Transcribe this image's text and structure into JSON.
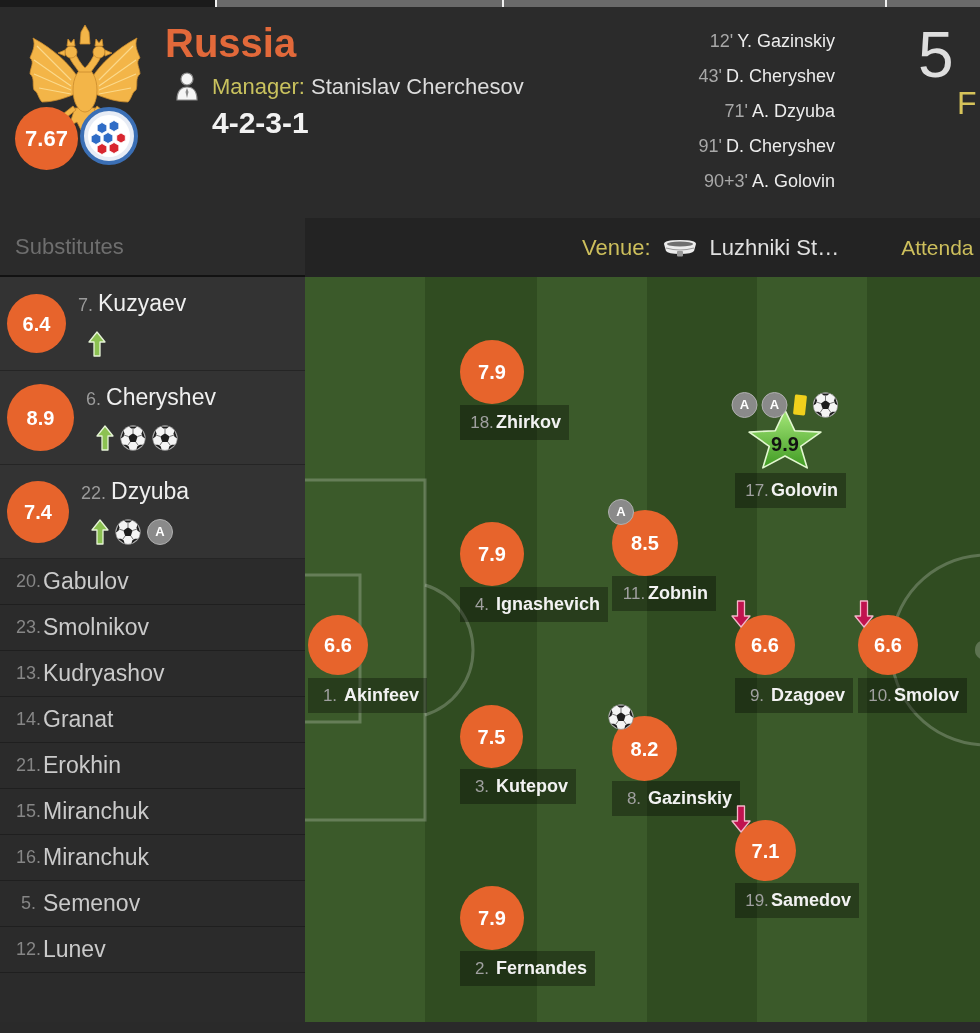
{
  "tabs": [
    {
      "selected": true
    },
    {
      "selected": false
    },
    {
      "selected": false
    },
    {
      "selected": false
    }
  ],
  "team": {
    "name": "Russia",
    "rating": "7.67",
    "manager_label": "Manager:",
    "manager": "Stanislav Cherchesov",
    "formation": "4-2-3-1"
  },
  "goals": [
    {
      "minute": "12'",
      "scorer": "Y. Gazinskiy"
    },
    {
      "minute": "43'",
      "scorer": "D. Cheryshev"
    },
    {
      "minute": "71'",
      "scorer": "A. Dzyuba"
    },
    {
      "minute": "91'",
      "scorer": "D. Cheryshev"
    },
    {
      "minute": "90+3'",
      "scorer": "A. Golovin"
    }
  ],
  "score": {
    "value": "5",
    "label": "F"
  },
  "match_info": {
    "venue_label": "Venue:",
    "venue": "Luzhniki St…",
    "attendance_label": "Attenda"
  },
  "substitutes": {
    "title": "Substitutes",
    "players": [
      {
        "kind": "played",
        "number": "7.",
        "name": "Kuzyaev",
        "rating": "6.4",
        "man_of_the_match": false,
        "events": [
          {
            "kind": "sub_on"
          }
        ]
      },
      {
        "kind": "played",
        "number": "6.",
        "name": "Cheryshev",
        "rating": "8.9",
        "man_of_the_match": false,
        "events": [
          {
            "kind": "sub_on"
          },
          {
            "kind": "goal"
          },
          {
            "kind": "goal"
          }
        ]
      },
      {
        "kind": "played",
        "number": "22.",
        "name": "Dzyuba",
        "rating": "7.4",
        "man_of_the_match": false,
        "events": [
          {
            "kind": "sub_on"
          },
          {
            "kind": "goal"
          },
          {
            "kind": "assist",
            "label": "A"
          }
        ]
      },
      {
        "kind": "unused",
        "number": "20.",
        "name": "Gabulov"
      },
      {
        "kind": "unused",
        "number": "23.",
        "name": "Smolnikov"
      },
      {
        "kind": "unused",
        "number": "13.",
        "name": "Kudryashov"
      },
      {
        "kind": "unused",
        "number": "14.",
        "name": "Granat"
      },
      {
        "kind": "unused",
        "number": "21.",
        "name": "Erokhin"
      },
      {
        "kind": "unused",
        "number": "15.",
        "name": "Miranchuk"
      },
      {
        "kind": "unused",
        "number": "16.",
        "name": "Miranchuk"
      },
      {
        "kind": "unused",
        "number": "5.",
        "name": "Semenov"
      },
      {
        "kind": "unused",
        "number": "12.",
        "name": "Lunev"
      }
    ]
  },
  "lineup": {
    "lines": [
      {
        "players": [
          {
            "number": "1.",
            "name": "Akinfeev",
            "rating": "6.6",
            "man_of_the_match": false
          }
        ]
      },
      {
        "players": [
          {
            "number": "18.",
            "name": "Zhirkov",
            "rating": "7.9",
            "man_of_the_match": false
          },
          {
            "number": "4.",
            "name": "Ignashevich",
            "rating": "7.9",
            "man_of_the_match": false
          },
          {
            "number": "3.",
            "name": "Kutepov",
            "rating": "7.5",
            "man_of_the_match": false
          },
          {
            "number": "2.",
            "name": "Fernandes",
            "rating": "7.9",
            "man_of_the_match": false
          }
        ]
      },
      {
        "players": [
          {
            "number": "11.",
            "name": "Zobnin",
            "rating": "8.5",
            "man_of_the_match": false,
            "events": [
              {
                "kind": "assist",
                "label": "A"
              }
            ]
          },
          {
            "number": "8.",
            "name": "Gazinskiy",
            "rating": "8.2",
            "man_of_the_match": false,
            "events": [
              {
                "kind": "goal"
              }
            ]
          }
        ]
      },
      {
        "players": [
          {
            "number": "17.",
            "name": "Golovin",
            "rating": "9.9",
            "man_of_the_match": true,
            "events": [
              {
                "kind": "assist",
                "label": "A"
              },
              {
                "kind": "assist",
                "label": "A"
              },
              {
                "kind": "yellow_card"
              },
              {
                "kind": "goal"
              }
            ]
          },
          {
            "number": "9.",
            "name": "Dzagoev",
            "rating": "6.6",
            "man_of_the_match": false,
            "events": [
              {
                "kind": "sub_off"
              }
            ]
          },
          {
            "number": "19.",
            "name": "Samedov",
            "rating": "7.1",
            "man_of_the_match": false,
            "events": [
              {
                "kind": "sub_off"
              }
            ]
          }
        ]
      },
      {
        "players": [
          {
            "number": "10.",
            "name": "Smolov",
            "rating": "6.6",
            "man_of_the_match": false,
            "events": [
              {
                "kind": "sub_off"
              }
            ]
          }
        ]
      }
    ]
  }
}
